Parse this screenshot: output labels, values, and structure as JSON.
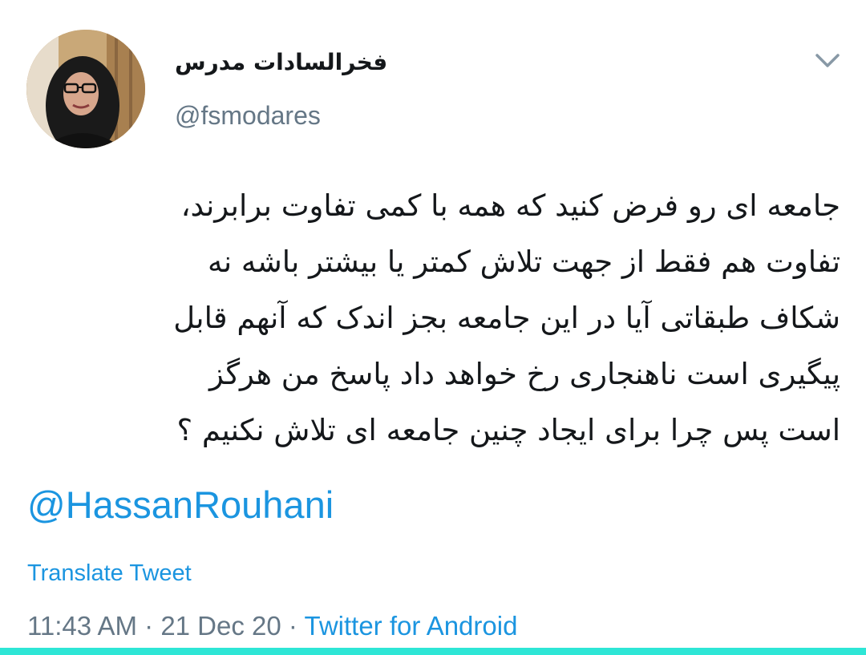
{
  "tweet": {
    "author": {
      "display_name": "فخرالسادات مدرس",
      "handle": "@fsmodares"
    },
    "text_lines": [
      "جامعه ای رو فرض کنید که همه با کمی تفاوت برابرند،",
      "تفاوت هم فقط از جهت تلاش کمتر یا بیشتر باشه نه",
      "شکاف طبقاتی آیا در این جامعه بجز اندک که آنهم قابل",
      "پیگیری است ناهنجاری رخ خواهد داد پاسخ من هرگز",
      "است پس چرا برای ایجاد چنین جامعه ای تلاش نکنیم ؟"
    ],
    "mention": "@HassanRouhani",
    "translate_label": "Translate Tweet",
    "time": "11:43 AM",
    "date": "21 Dec 20",
    "separator": " · ",
    "source": "Twitter for Android"
  },
  "icons": {
    "menu": "chevron-down-icon"
  },
  "colors": {
    "link": "#1b95e0",
    "text": "#14171a",
    "secondary": "#657786",
    "bottom_bar": "#2ee6d6"
  }
}
